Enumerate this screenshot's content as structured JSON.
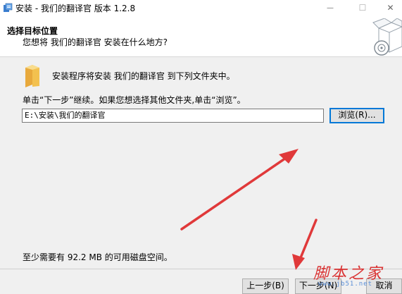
{
  "window": {
    "title": "安装 - 我们的翻译官 版本 1.2.8",
    "minimize_glyph": "—",
    "maximize_glyph": "☐",
    "close_glyph": "✕"
  },
  "header": {
    "title": "选择目标位置",
    "subtitle": "您想将 我们的翻译官 安装在什么地方?"
  },
  "body": {
    "intro": "安装程序将安装 我们的翻译官 到下列文件夹中。",
    "instruction": "单击“下一步”继续。如果您想选择其他文件夹,单击“浏览”。",
    "install_path": "E:\\安装\\我们的翻译官",
    "browse_label": "浏览(R)...",
    "space_required": "至少需要有 92.2 MB 的可用磁盘空间。"
  },
  "footer": {
    "back_label": "上一步(B)",
    "next_label": "下一步(N)",
    "cancel_label": "取消"
  },
  "watermark": {
    "text": "脚本之家",
    "url": "www.jb51.net"
  },
  "icons": {
    "app": "installer-icon",
    "header_graphic": "box-disc-icon",
    "folder": "folder-icon"
  },
  "colors": {
    "accent": "#0078d7",
    "arrow": "#e0393a",
    "watermark": "#d81e1e"
  }
}
